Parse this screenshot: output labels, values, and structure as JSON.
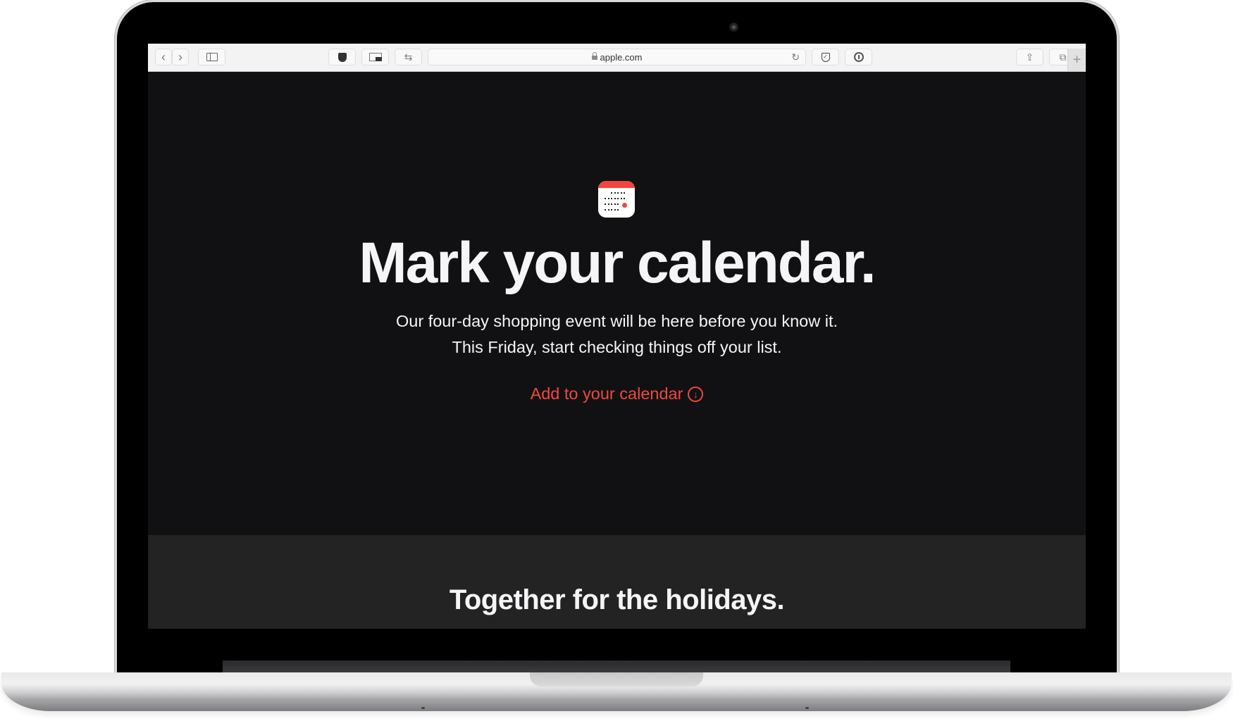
{
  "browser": {
    "url": "apple.com",
    "toolbar_icons": [
      {
        "name": "back-icon",
        "glyph": "‹"
      },
      {
        "name": "forward-icon",
        "glyph": "›"
      },
      {
        "name": "sidebar-icon",
        "glyph": "▯"
      },
      {
        "name": "ublock-shield-icon",
        "glyph": "⛉"
      },
      {
        "name": "picture-in-picture-icon",
        "glyph": "▭"
      },
      {
        "name": "swap-arrows-icon",
        "glyph": "⇆"
      },
      {
        "name": "reload-icon",
        "glyph": "↻"
      },
      {
        "name": "adguard-shield-icon",
        "glyph": "✓"
      },
      {
        "name": "onepassword-icon",
        "glyph": "⓪"
      },
      {
        "name": "share-icon",
        "glyph": "⇪"
      },
      {
        "name": "tabs-overview-icon",
        "glyph": "⧉"
      },
      {
        "name": "new-tab-icon",
        "glyph": "+"
      }
    ]
  },
  "hero": {
    "icon": "calendar-icon",
    "headline": "Mark your calendar.",
    "subtext_line1": "Our four-day shopping event will be here before you know it.",
    "subtext_line2": "This Friday, start checking things off your list.",
    "cta_label": "Add to your calendar",
    "cta_icon": "download-circle-icon",
    "cta_glyph": "↓",
    "accent_color": "#f0483e"
  },
  "section2": {
    "heading": "Together for the holidays."
  }
}
